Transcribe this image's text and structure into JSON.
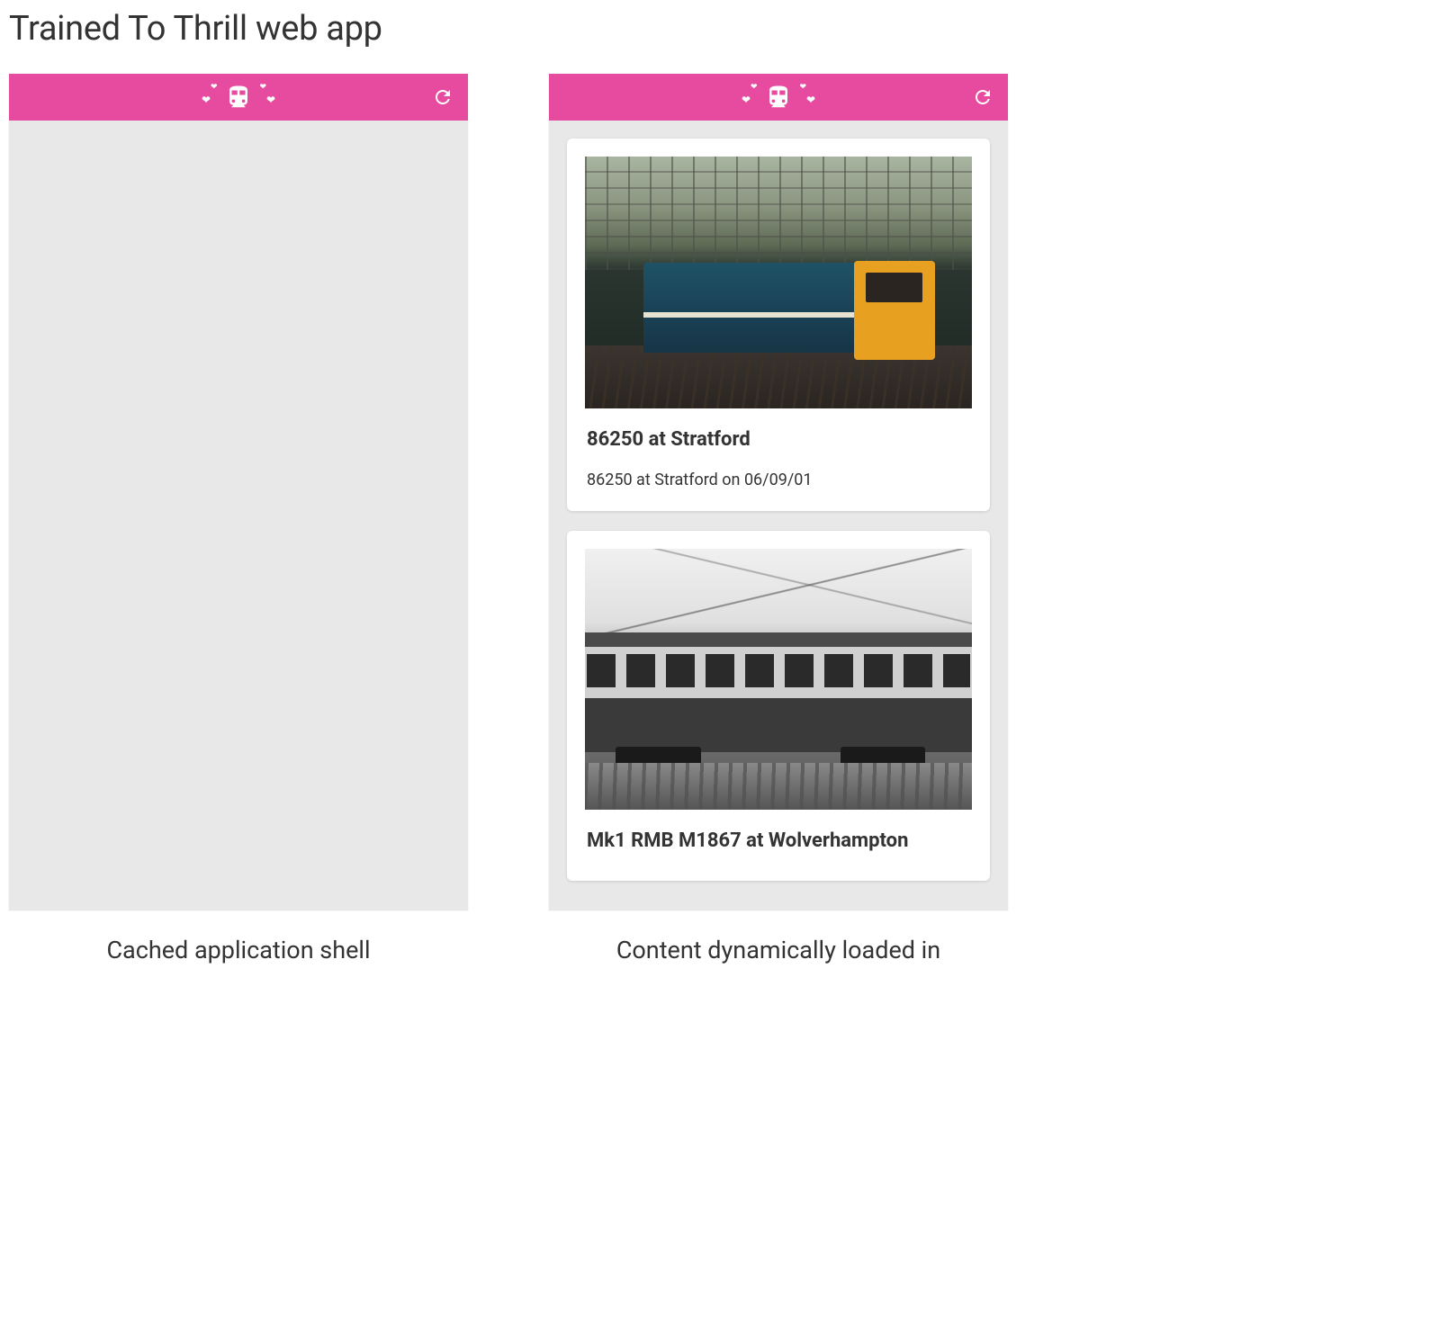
{
  "page": {
    "title": "Trained To Thrill web app"
  },
  "panels": {
    "left": {
      "caption": "Cached application shell"
    },
    "right": {
      "caption": "Content dynamically loaded in",
      "cards": [
        {
          "title": "86250 at Stratford",
          "description": "86250 at Stratford on 06/09/01"
        },
        {
          "title": "Mk1 RMB M1867 at Wolverhampton",
          "description": ""
        }
      ]
    }
  },
  "header": {
    "logo_name": "trained-to-thrill-logo",
    "refresh_name": "refresh"
  }
}
